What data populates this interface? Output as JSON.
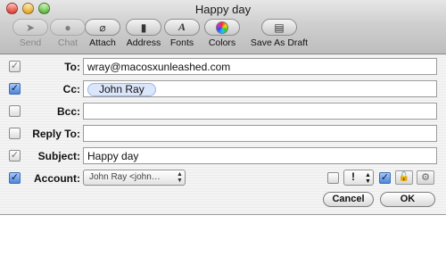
{
  "window": {
    "title": "Happy day"
  },
  "toolbar": {
    "send": "Send",
    "chat": "Chat",
    "attach": "Attach",
    "address": "Address",
    "fonts": "Fonts",
    "fonts_glyph": "A",
    "colors": "Colors",
    "save_as_draft": "Save As Draft"
  },
  "fields": {
    "to": {
      "label": "To:",
      "value": "wray@macosxunleashed.com"
    },
    "cc": {
      "label": "Cc:",
      "token": "John Ray"
    },
    "bcc": {
      "label": "Bcc:",
      "value": ""
    },
    "reply_to": {
      "label": "Reply To:",
      "value": ""
    },
    "subject": {
      "label": "Subject:",
      "value": "Happy day"
    },
    "account": {
      "label": "Account:",
      "value": "John Ray <john…"
    }
  },
  "options": {
    "priority": "!"
  },
  "buttons": {
    "cancel": "Cancel",
    "ok": "OK"
  },
  "icons": {
    "checkmark": "✓",
    "lock": "🔓",
    "gear": "⚙",
    "stepper": "▲▼"
  },
  "colors": {
    "checkbox_checked": "#4d86d9",
    "token_bg": "#dbe6fa"
  }
}
